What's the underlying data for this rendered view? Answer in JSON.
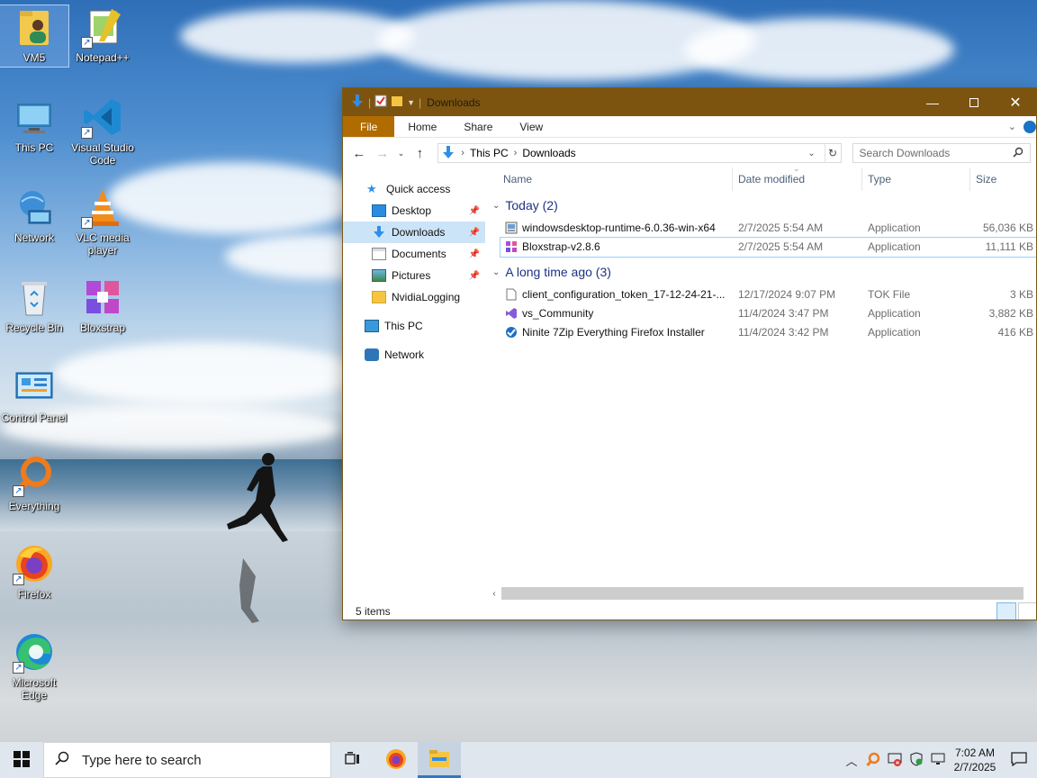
{
  "desktop": {
    "icons": [
      {
        "label": "VM5",
        "icon": "user-folder-icon"
      },
      {
        "label": "Notepad++",
        "icon": "notepadpp-icon"
      },
      {
        "label": "This PC",
        "icon": "this-pc-icon"
      },
      {
        "label": "Visual Studio Code",
        "icon": "vscode-icon"
      },
      {
        "label": "Network",
        "icon": "network-icon"
      },
      {
        "label": "VLC media player",
        "icon": "vlc-icon"
      },
      {
        "label": "Recycle Bin",
        "icon": "recycle-bin-icon"
      },
      {
        "label": "Bloxstrap",
        "icon": "bloxstrap-icon"
      },
      {
        "label": "Control Panel",
        "icon": "control-panel-icon"
      },
      {
        "label": "Everything",
        "icon": "everything-search-icon"
      },
      {
        "label": "Firefox",
        "icon": "firefox-icon"
      },
      {
        "label": "Microsoft Edge",
        "icon": "edge-icon"
      }
    ]
  },
  "explorer": {
    "title": "Downloads",
    "ribbon_tabs": [
      "File",
      "Home",
      "Share",
      "View"
    ],
    "address": {
      "root": "This PC",
      "current": "Downloads"
    },
    "search_placeholder": "Search Downloads",
    "nav": {
      "quick_access": "Quick access",
      "pinned": [
        {
          "label": "Desktop",
          "pinned": true
        },
        {
          "label": "Downloads",
          "pinned": true,
          "selected": true
        },
        {
          "label": "Documents",
          "pinned": true
        },
        {
          "label": "Pictures",
          "pinned": true
        },
        {
          "label": "NvidiaLogging",
          "pinned": false
        }
      ],
      "this_pc": "This PC",
      "network": "Network"
    },
    "columns": [
      "Name",
      "Date modified",
      "Type",
      "Size"
    ],
    "groups": [
      {
        "label": "Today (2)",
        "files": [
          {
            "name": "windowsdesktop-runtime-6.0.36-win-x64",
            "date": "2/7/2025 5:54 AM",
            "type": "Application",
            "size": "56,036 KB",
            "icon": "installer-icon"
          },
          {
            "name": "Bloxstrap-v2.8.6",
            "date": "2/7/2025 5:54 AM",
            "type": "Application",
            "size": "11,111 KB",
            "icon": "bloxstrap-icon",
            "selected": true
          }
        ]
      },
      {
        "label": "A long time ago (3)",
        "files": [
          {
            "name": "client_configuration_token_17-12-24-21-...",
            "date": "12/17/2024 9:07 PM",
            "type": "TOK File",
            "size": "3 KB",
            "icon": "file-icon"
          },
          {
            "name": "vs_Community",
            "date": "11/4/2024 3:47 PM",
            "type": "Application",
            "size": "3,882 KB",
            "icon": "visual-studio-icon"
          },
          {
            "name": "Ninite 7Zip Everything Firefox Installer",
            "date": "11/4/2024 3:42 PM",
            "type": "Application",
            "size": "416 KB",
            "icon": "ninite-icon"
          }
        ]
      }
    ],
    "status": "5 items"
  },
  "taskbar": {
    "search_placeholder": "Type here to search",
    "time": "7:02 AM",
    "date": "2/7/2025"
  },
  "colors": {
    "titlebar": "#7c5410",
    "file_tab": "#b06c00",
    "group_header": "#1e3287",
    "selection": "#cce4f7"
  }
}
